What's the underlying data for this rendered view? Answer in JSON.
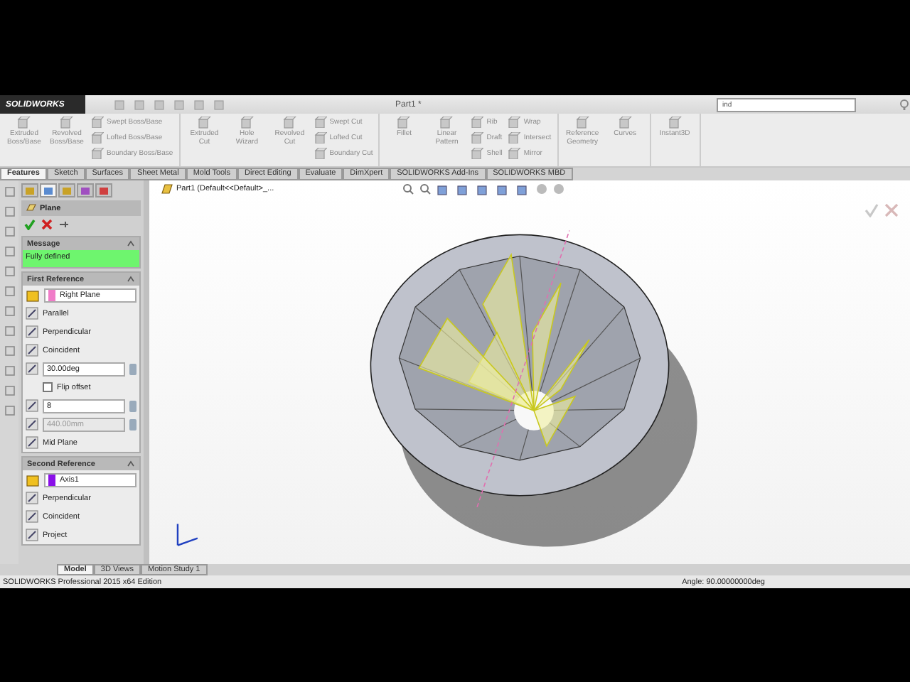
{
  "app": {
    "logo": "SOLIDWORKS",
    "title": "Part1 *",
    "search": {
      "value": "ind"
    }
  },
  "ribbon": [
    {
      "items": [
        {
          "kind": "large",
          "label": "Extruded Boss/Base"
        },
        {
          "kind": "large",
          "label": "Revolved Boss/Base"
        },
        {
          "kind": "stack",
          "labels": [
            "Swept Boss/Base",
            "Lofted Boss/Base",
            "Boundary Boss/Base"
          ]
        }
      ]
    },
    {
      "items": [
        {
          "kind": "large",
          "label": "Extruded Cut"
        },
        {
          "kind": "large",
          "label": "Hole Wizard"
        },
        {
          "kind": "large",
          "label": "Revolved Cut"
        },
        {
          "kind": "stack",
          "labels": [
            "Swept Cut",
            "Lofted Cut",
            "Boundary Cut"
          ]
        }
      ]
    },
    {
      "items": [
        {
          "kind": "large",
          "label": "Fillet"
        },
        {
          "kind": "large",
          "label": "Linear Pattern"
        },
        {
          "kind": "stack",
          "labels": [
            "Rib",
            "Draft",
            "Shell"
          ]
        },
        {
          "kind": "stack",
          "labels": [
            "Wrap",
            "Intersect",
            "Mirror"
          ]
        }
      ]
    },
    {
      "items": [
        {
          "kind": "large",
          "label": "Reference Geometry"
        },
        {
          "kind": "large",
          "label": "Curves"
        }
      ]
    },
    {
      "items": [
        {
          "kind": "large",
          "label": "Instant3D"
        }
      ]
    }
  ],
  "tabs": [
    {
      "label": "Features",
      "selected": true
    },
    {
      "label": "Sketch",
      "selected": false
    },
    {
      "label": "Surfaces",
      "selected": false
    },
    {
      "label": "Sheet Metal",
      "selected": false
    },
    {
      "label": "Mold Tools",
      "selected": false
    },
    {
      "label": "Direct Editing",
      "selected": false
    },
    {
      "label": "Evaluate",
      "selected": false
    },
    {
      "label": "DimXpert",
      "selected": false
    },
    {
      "label": "SOLIDWORKS Add-Ins",
      "selected": false
    },
    {
      "label": "SOLIDWORKS MBD",
      "selected": false
    }
  ],
  "panel_tabs": [
    {
      "selected": false
    },
    {
      "selected": true
    },
    {
      "selected": false
    },
    {
      "selected": false
    },
    {
      "selected": false
    }
  ],
  "property_manager": {
    "title": "Plane",
    "sections": [
      {
        "title": "Message",
        "rows": [
          {
            "kind": "message",
            "text": "Fully defined"
          }
        ]
      },
      {
        "title": "First Reference",
        "rows": [
          {
            "kind": "select",
            "text": "Right Plane",
            "color": "#f07cc8"
          },
          {
            "kind": "option",
            "text": "Parallel"
          },
          {
            "kind": "option",
            "text": "Perpendicular"
          },
          {
            "kind": "option",
            "text": "Coincident"
          },
          {
            "kind": "spin",
            "text": "30.00deg",
            "disabled": false
          },
          {
            "kind": "checkbox",
            "text": "Flip offset",
            "checked": false
          },
          {
            "kind": "spin",
            "text": "8",
            "disabled": false
          },
          {
            "kind": "spin",
            "text": "440.00mm",
            "disabled": true
          },
          {
            "kind": "option",
            "text": "Mid Plane"
          }
        ]
      },
      {
        "title": "Second Reference",
        "rows": [
          {
            "kind": "select",
            "text": "Axis1",
            "color": "#8a10e8"
          },
          {
            "kind": "option",
            "text": "Perpendicular"
          },
          {
            "kind": "option",
            "text": "Coincident"
          },
          {
            "kind": "option",
            "text": "Project"
          }
        ]
      }
    ]
  },
  "feature_tree": {
    "label": "Part1  (Default<<Default>_..."
  },
  "bottom_tabs": [
    {
      "label": "Model",
      "selected": true
    },
    {
      "label": "3D Views",
      "selected": false
    },
    {
      "label": "Motion Study 1",
      "selected": false
    }
  ],
  "status_bar": {
    "left": "SOLIDWORKS Professional 2015 x64 Edition",
    "right": "Angle: 90.00000000deg"
  }
}
